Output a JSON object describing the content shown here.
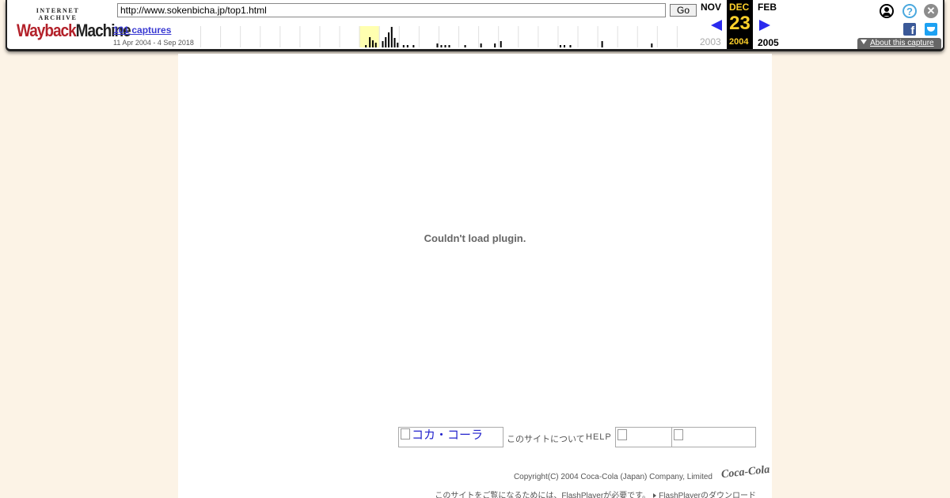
{
  "toolbar": {
    "logo_top": "INTERNET ARCHIVE",
    "logo_word_1": "Wayback",
    "logo_word_2": "Machine",
    "url": "http://www.sokenbicha.jp/top1.html",
    "go_label": "Go",
    "captures_label": "101 captures",
    "capture_range": "11 Apr 2004 - 4 Sep 2018",
    "prev_month": "NOV",
    "current_month": "DEC",
    "current_day": "23",
    "current_year": "2004",
    "next_month": "FEB",
    "prev_year": "2003",
    "next_year": "2005",
    "about_label": "About this capture",
    "help_glyph": "?",
    "close_glyph": "✕",
    "facebook_glyph": "f",
    "icons": [
      "user-icon",
      "help-icon",
      "close-icon",
      "facebook-icon",
      "twitter-icon",
      "prev-arrow-icon",
      "next-arrow-icon"
    ],
    "colors": {
      "accent_gold": "#ffd12b",
      "arrow_blue": "#2a2aee",
      "logo_red": "#b3212a"
    }
  },
  "sparkline": {
    "highlighted_year_index": 8,
    "years": 25,
    "bars": [
      {
        "year_pos": 8.3,
        "h": 3
      },
      {
        "year_pos": 8.5,
        "h": 13
      },
      {
        "year_pos": 8.65,
        "h": 9
      },
      {
        "year_pos": 8.8,
        "h": 6
      },
      {
        "year_pos": 9.15,
        "h": 8
      },
      {
        "year_pos": 9.3,
        "h": 13
      },
      {
        "year_pos": 9.45,
        "h": 19
      },
      {
        "year_pos": 9.6,
        "h": 26
      },
      {
        "year_pos": 9.75,
        "h": 12
      },
      {
        "year_pos": 9.9,
        "h": 6
      },
      {
        "year_pos": 10.2,
        "h": 3
      },
      {
        "year_pos": 10.4,
        "h": 3
      },
      {
        "year_pos": 10.7,
        "h": 3
      },
      {
        "year_pos": 11.9,
        "h": 5
      },
      {
        "year_pos": 12.1,
        "h": 3
      },
      {
        "year_pos": 12.3,
        "h": 3
      },
      {
        "year_pos": 12.5,
        "h": 3
      },
      {
        "year_pos": 13.3,
        "h": 3
      },
      {
        "year_pos": 14.1,
        "h": 5
      },
      {
        "year_pos": 14.8,
        "h": 5
      },
      {
        "year_pos": 15.1,
        "h": 8
      },
      {
        "year_pos": 18.1,
        "h": 3
      },
      {
        "year_pos": 18.3,
        "h": 3
      },
      {
        "year_pos": 18.6,
        "h": 3
      },
      {
        "year_pos": 20.2,
        "h": 8
      },
      {
        "year_pos": 22.7,
        "h": 5
      }
    ]
  },
  "page": {
    "plugin_message": "Couldn't load plugin.",
    "coke_logo_alt": "コカ・コーラ",
    "about_site": "このサイトについて",
    "help": "HELP",
    "copyright": "Copyright(C) 2004 Coca-Cola (Japan) Company, Limited",
    "coke_script": "Coca-Cola",
    "flash_note": "このサイトをご覧になるためには、FlashPlayerが必要です。",
    "flash_link": "FlashPlayerのダウンロード"
  }
}
